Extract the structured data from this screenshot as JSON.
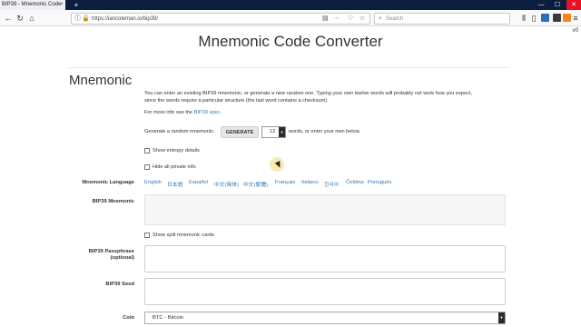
{
  "browser": {
    "tab_title": "BIP39 - Mnemonic Code",
    "tab_close": "×",
    "new_tab": "+",
    "url": "https://iancoleman.io/bip39/",
    "search_placeholder": "Search",
    "win_min": "—",
    "win_max": "☐",
    "win_close": "✕",
    "side_text": "v0"
  },
  "page": {
    "title": "Mnemonic Code Converter",
    "section": "Mnemonic",
    "desc_line1": "You can enter an existing BIP39 mnemonic, or generate a new random one. Typing your own twelve words will probably not work how you expect,",
    "desc_line2": "since the words require a particular structure (the last word contains a checksum).",
    "more_info_prefix": "For more info see the ",
    "more_info_link": "BIP39 spec",
    "more_info_suffix": "."
  },
  "generate": {
    "label": "Generate a random mnemonic:",
    "button": "GENERATE",
    "words_value": "12",
    "after": "words, or enter your own below."
  },
  "options": {
    "show_entropy": "Show entropy details",
    "hide_private": "Hide all private info",
    "show_split": "Show split mnemonic cards"
  },
  "labels": {
    "language": "Mnemonic Language",
    "mnemonic": "BIP39 Mnemonic",
    "passphrase_line1": "BIP39 Passphrase",
    "passphrase_line2": "(optional)",
    "seed": "BIP39 Seed",
    "coin": "Coin"
  },
  "languages": [
    "English",
    "日本語",
    "Español",
    "中文(简体)",
    "中文(繁體)",
    "Français",
    "Italiano",
    "한국어",
    "Čeština",
    "Português"
  ],
  "coin": {
    "selected": "BTC - Bitcoin"
  }
}
